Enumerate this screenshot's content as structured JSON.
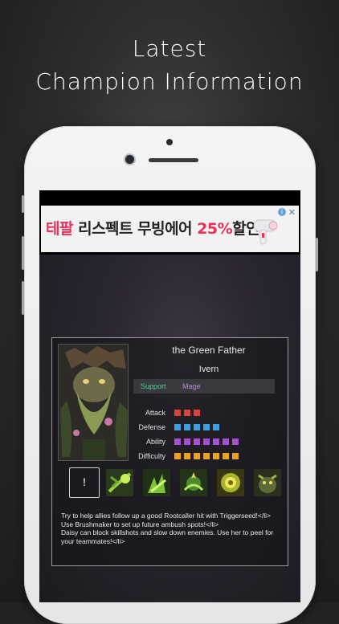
{
  "headline": {
    "line1": "Latest",
    "line2": "Champion Information"
  },
  "ad": {
    "text_brand": "테팔",
    "text_main": " 리스펙트 무빙에어 ",
    "text_pct": "25%",
    "text_tail": "할인!",
    "info_glyph": "i",
    "close_glyph": "✕",
    "product_icon": "hair-dryer-icon"
  },
  "champion": {
    "title": "the Green Father",
    "name": "Ivern",
    "tags": [
      "Support",
      "Mage"
    ],
    "stats": [
      {
        "label": "Attack",
        "value": 3,
        "color": "#d9453a"
      },
      {
        "label": "Defense",
        "value": 5,
        "color": "#3ea0e0"
      },
      {
        "label": "Ability",
        "value": 7,
        "color": "#a64fd0"
      },
      {
        "label": "Difficulty",
        "value": 7,
        "color": "#f0a21e"
      }
    ],
    "abilities": [
      {
        "name": "passive-empty",
        "glyph": "!"
      },
      {
        "name": "ability-rootcaller-icon"
      },
      {
        "name": "ability-brushmaker-icon"
      },
      {
        "name": "ability-triggerseed-icon"
      },
      {
        "name": "ability-daisy-icon"
      },
      {
        "name": "ability-ultimate-icon"
      }
    ],
    "tips": [
      " Try to help allies follow up a good Rootcaller hit with Triggerseed!</li>",
      " Use Brushmaker to set up future ambush spots!</li>",
      " Daisy can block skillshots and slow down enemies. Use her to peel for your teammates!</li>"
    ]
  }
}
